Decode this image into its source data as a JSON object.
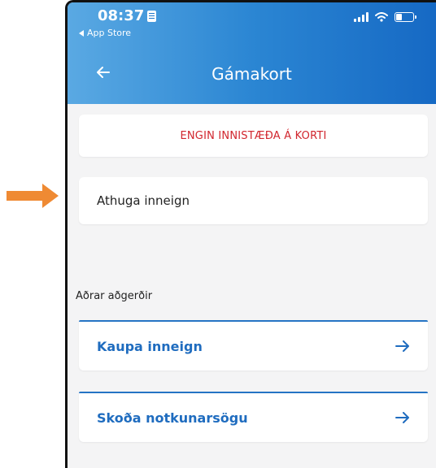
{
  "status_bar": {
    "time": "08:37",
    "back_app": "App Store"
  },
  "header": {
    "title": "Gámakort"
  },
  "balance": {
    "message": "ENGIN INNISTÆÐA Á KORTI"
  },
  "check_balance": {
    "label": "Athuga inneign"
  },
  "other_actions": {
    "heading": "Aðrar aðgerðir",
    "items": [
      {
        "label": "Kaupa inneign"
      },
      {
        "label": "Skoða notkunarsögu"
      }
    ]
  },
  "colors": {
    "accent": "#1f6cbf",
    "alert": "#d1262e",
    "annotation_arrow": "#ef8a33",
    "header_gradient_start": "#5aa9e3",
    "header_gradient_end": "#1669c4"
  }
}
